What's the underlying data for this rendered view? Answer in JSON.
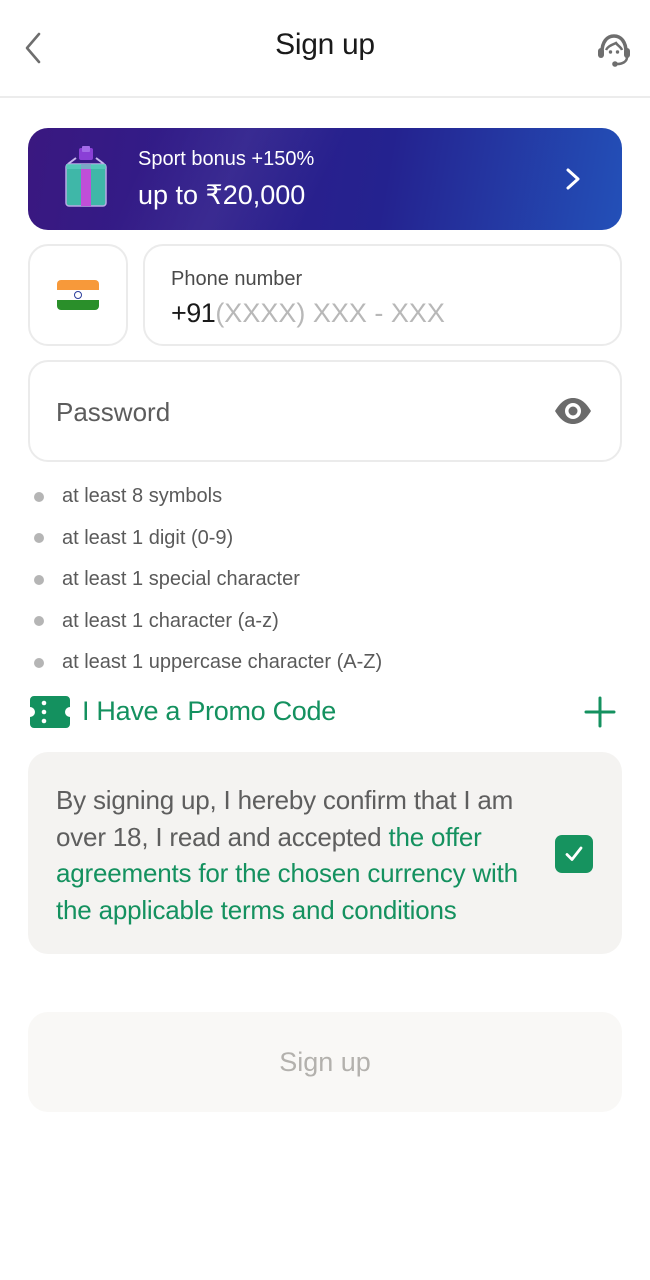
{
  "header": {
    "title": "Sign up",
    "back_icon": "chevron-left-icon",
    "support_icon": "headset-support-icon"
  },
  "banner": {
    "line1": "Sport bonus +150%",
    "line2": "up to ₹20,000",
    "icon": "gift-icon",
    "chevron_icon": "chevron-right-icon"
  },
  "phone": {
    "country_flag": "india-flag-icon",
    "label": "Phone number",
    "prefix": "+91",
    "placeholder_mask": "(XXXX) XXX - XXX"
  },
  "password": {
    "placeholder": "Password",
    "toggle_icon": "eye-icon"
  },
  "password_rules": [
    "at least 8 symbols",
    "at least 1 digit (0-9)",
    "at least 1 special character",
    "at least 1 character (a-z)",
    "at least 1 uppercase character (A-Z)"
  ],
  "promo": {
    "label": "I Have a Promo Code",
    "icon": "ticket-icon",
    "add_icon": "plus-icon"
  },
  "agreement": {
    "text_prefix": "By signing up, I hereby confirm that I am over 18, I read and accepted ",
    "link_text": "the offer agreements for the chosen currency with the applicable terms and conditions",
    "checked": true
  },
  "submit": {
    "label": "Sign up"
  },
  "colors": {
    "accent_green": "#14915f",
    "banner_start": "#3a1880",
    "banner_end": "#2350b8",
    "disabled_text": "#b3b1ad"
  }
}
